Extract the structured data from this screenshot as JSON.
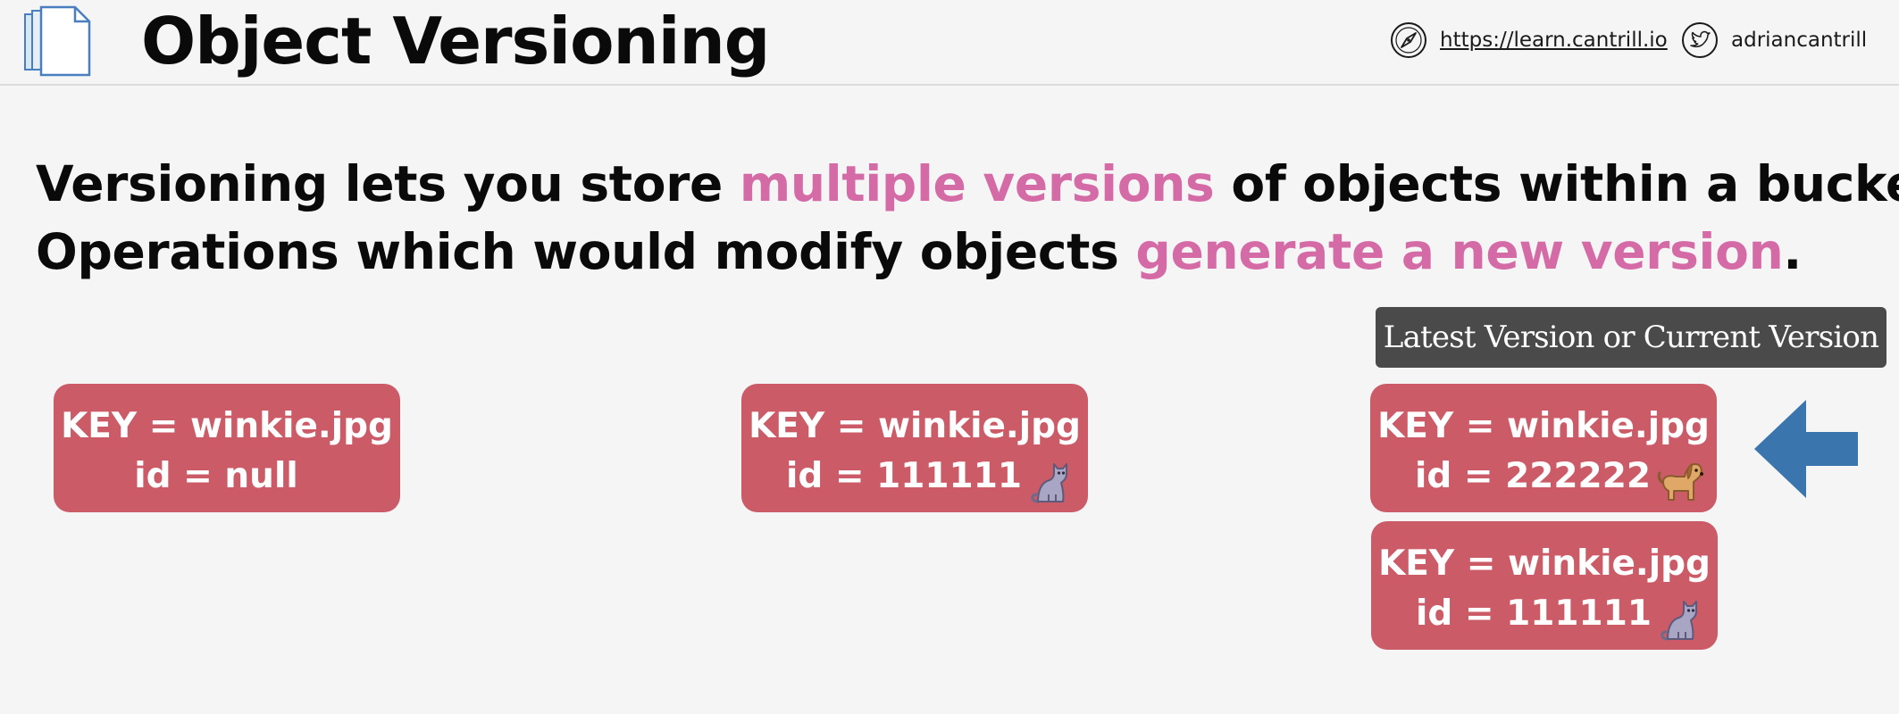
{
  "header": {
    "title": "Object Versioning",
    "website": "https://learn.cantrill.io",
    "twitter": "adriancantrill",
    "icons": {
      "document": "documents-icon",
      "website": "compass-icon",
      "twitter": "twitter-bird-icon"
    }
  },
  "statement": {
    "line1": {
      "before": "Versioning lets you store ",
      "highlight": "multiple versions",
      "after": " of objects within a bucket."
    },
    "line2": {
      "before": "Operations which would modify objects ",
      "highlight": "generate a new version",
      "after": "."
    }
  },
  "latest_label": "Latest Version or Current Version",
  "cards": [
    {
      "key_text": "KEY = winkie.jpg",
      "id_text": "id = null",
      "animal": ""
    },
    {
      "key_text": "KEY = winkie.jpg",
      "id_text": "id = 111111",
      "animal": "cat-icon"
    },
    {
      "key_text": "KEY = winkie.jpg",
      "id_text": "id = 222222",
      "animal": "dog-icon"
    },
    {
      "key_text": "KEY = winkie.jpg",
      "id_text": "id = 111111",
      "animal": "cat-icon"
    }
  ],
  "colors": {
    "background": "#f5f5f5",
    "card": "#cc5b68",
    "highlight": "#d46aa6",
    "label_bg": "#4a4a4a",
    "arrow": "#3a75ae"
  }
}
